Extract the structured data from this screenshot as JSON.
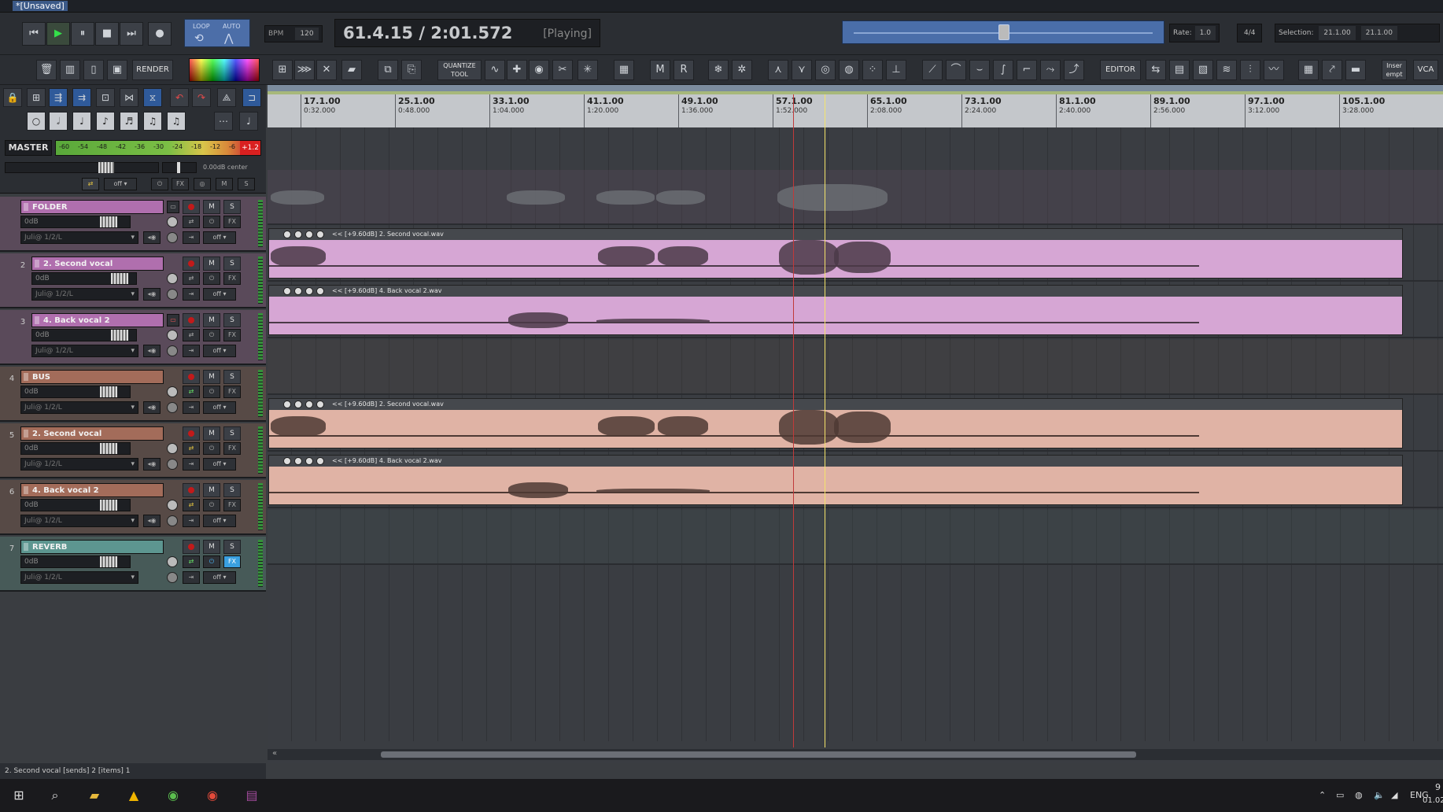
{
  "window": {
    "title": "*[Unsaved]"
  },
  "transport": {
    "buttons": [
      "⏮",
      "▶",
      "⏸",
      "■",
      "⏭",
      "●"
    ],
    "loop_label": "LOOP",
    "auto_label": "AUTO",
    "bpm_label": "BPM",
    "bpm_value": "120",
    "time": "61.4.15 / 2:01.572",
    "state": "[Playing]",
    "rate_label": "Rate:",
    "rate_value": "1.0",
    "timesig": "4/4",
    "selection_label": "Selection:",
    "selection_start": "21.1.00",
    "selection_end": "21.1.00"
  },
  "toolbar": {
    "render_label": "RENDER",
    "quantize_label": "QUANTIZE TOOL",
    "editor_label": "EDITOR",
    "insert_label": "Inser empt",
    "vca_label": "VCA"
  },
  "master": {
    "label": "MASTER",
    "meter_ticks": [
      "-60",
      "-54",
      "-48",
      "-42",
      "-36",
      "-30",
      "-24",
      "-18",
      "-12",
      "-6"
    ],
    "clip_value": "+1.2",
    "volume_readout": "0.00dB center",
    "auto_label": "off",
    "fx_label": "FX",
    "m_label": "M",
    "s_label": "S"
  },
  "tracks": [
    {
      "num": "",
      "name": "FOLDER",
      "color": "#c98bc8",
      "vol": "0dB",
      "io": "Juli@ 1/2/L",
      "auto": "off",
      "item": null
    },
    {
      "num": "2",
      "name": "2. Second vocal",
      "color": "#c98bc8",
      "vol": "0dB",
      "io": "Juli@ 1/2/L",
      "auto": "off",
      "item": "<< [+9.60dB] 2. Second vocal.wav"
    },
    {
      "num": "3",
      "name": "4. Back vocal 2",
      "color": "#c98bc8",
      "vol": "0dB",
      "io": "Juli@ 1/2/L",
      "auto": "off",
      "item": "<< [+9.60dB] 4. Back vocal 2.wav"
    },
    {
      "num": "4",
      "name": "BUS",
      "color": "#c48c78",
      "vol": "0dB",
      "io": "Juli@ 1/2/L",
      "auto": "off",
      "item": null
    },
    {
      "num": "5",
      "name": "2. Second vocal",
      "color": "#c48c78",
      "vol": "0dB",
      "io": "Juli@ 1/2/L",
      "auto": "off",
      "item": "<< [+9.60dB] 2. Second vocal.wav"
    },
    {
      "num": "6",
      "name": "4. Back vocal 2",
      "color": "#c48c78",
      "vol": "0dB",
      "io": "Juli@ 1/2/L",
      "auto": "off",
      "item": "<< [+9.60dB] 4. Back vocal 2.wav"
    },
    {
      "num": "7",
      "name": "REVERB",
      "color": "#6fa6a0",
      "vol": "0dB",
      "io": "Juli@ 1/2/L",
      "auto": "off",
      "item": null
    }
  ],
  "track_buttons": {
    "m": "M",
    "s": "S",
    "fx": "FX"
  },
  "ruler": [
    {
      "bar": "17.1.00",
      "time": "0:32.000"
    },
    {
      "bar": "25.1.00",
      "time": "0:48.000"
    },
    {
      "bar": "33.1.00",
      "time": "1:04.000"
    },
    {
      "bar": "41.1.00",
      "time": "1:20.000"
    },
    {
      "bar": "49.1.00",
      "time": "1:36.000"
    },
    {
      "bar": "57.1.00",
      "time": "1:52.000"
    },
    {
      "bar": "65.1.00",
      "time": "2:08.000"
    },
    {
      "bar": "73.1.00",
      "time": "2:24.000"
    },
    {
      "bar": "81.1.00",
      "time": "2:40.000"
    },
    {
      "bar": "89.1.00",
      "time": "2:56.000"
    },
    {
      "bar": "97.1.00",
      "time": "3:12.000"
    },
    {
      "bar": "105.1.00",
      "time": "3:28.000"
    }
  ],
  "status": "2. Second vocal [sends] 2 [items] 1",
  "taskbar": {
    "icons": [
      "windows-start",
      "search",
      "file-explorer",
      "app-triangle",
      "chrome-like",
      "chrome",
      "winrar"
    ],
    "lang": "ENG",
    "clock_time": "9",
    "clock_date": "01.02"
  }
}
